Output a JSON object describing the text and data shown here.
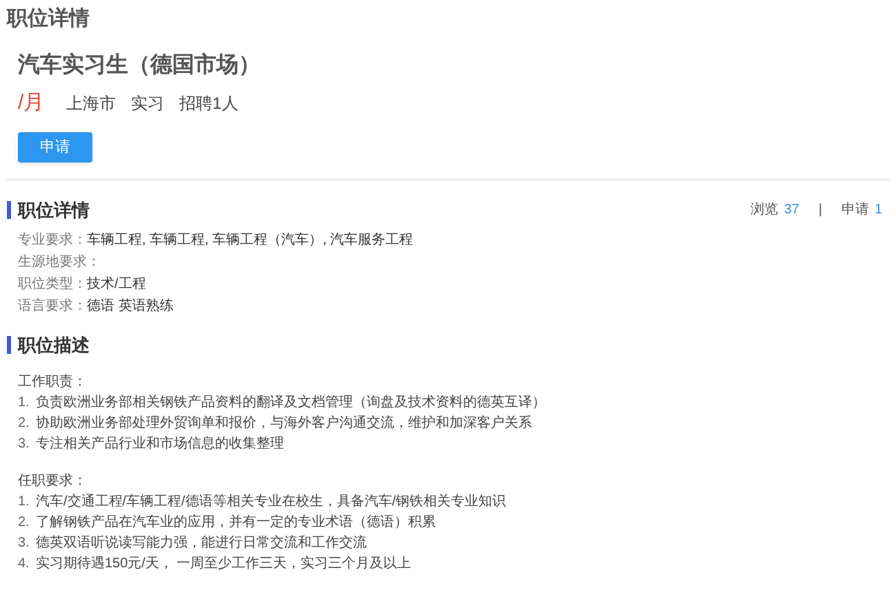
{
  "page_title": "职位详情",
  "job": {
    "title": "汽车实习生（德国市场）",
    "salary": "/月",
    "tags": [
      "上海市",
      "实习",
      "招聘1人"
    ],
    "apply_button": "申请"
  },
  "details": {
    "heading": "职位详情",
    "stats": [
      {
        "label": "浏览",
        "value": "37"
      },
      {
        "label": "申请",
        "value": "1"
      }
    ],
    "separator": "|",
    "fields": [
      {
        "label": "专业要求：",
        "value": "车辆工程, 车辆工程, 车辆工程（汽车）, 汽车服务工程"
      },
      {
        "label": "生源地要求："
      },
      {
        "label": "职位类型：",
        "value": "技术/工程"
      },
      {
        "label": "语言要求：",
        "value": "德语 英语熟练"
      }
    ]
  },
  "description": {
    "heading": "职位描述",
    "blocks": [
      {
        "title": "工作职责：",
        "items": [
          {
            "number": "1.",
            "text": "负责欧洲业务部相关钢铁产品资料的翻译及文档管理（询盘及技术资料的德英互译）"
          },
          {
            "number": "2.",
            "text": "协助欧洲业务部处理外贸询单和报价，与海外客户沟通交流，维护和加深客户关系"
          },
          {
            "number": "3.",
            "text": "专注相关产品行业和市场信息的收集整理"
          }
        ]
      },
      {
        "title": "任职要求：",
        "items": [
          {
            "number": "1.",
            "text": "汽车/交通工程/车辆工程/德语等相关专业在校生，具备汽车/钢铁相关专业知识"
          },
          {
            "number": "2.",
            "text": "了解钢铁产品在汽车业的应用，并有一定的专业术语（德语）积累"
          },
          {
            "number": "3.",
            "text": "德英双语听说读写能力强，能进行日常交流和工作交流"
          },
          {
            "number": "4.",
            "text": "实习期待遇150元/天， 一周至少工作三天，实习三个月及以上"
          }
        ]
      }
    ]
  }
}
